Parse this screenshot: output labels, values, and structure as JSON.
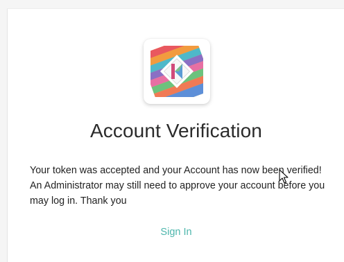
{
  "page": {
    "title": "Account Verification",
    "message": "Your token was accepted and your Account has now been verified! An Administrator may still need to approve your account before you may log in. Thank you",
    "signin_label": "Sign In"
  },
  "icons": {
    "logo": "app-logo",
    "cursor": "mouse-pointer-icon"
  },
  "colors": {
    "link": "#4db6ac",
    "title": "#2b2b2b",
    "text": "#222222"
  }
}
